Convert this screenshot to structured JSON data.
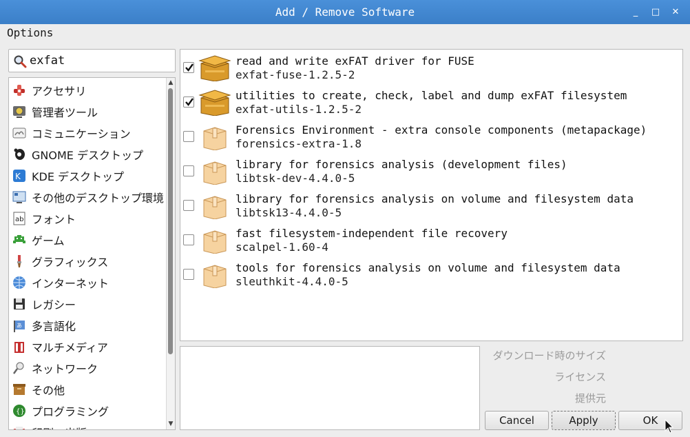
{
  "window": {
    "title": "Add / Remove Software",
    "minimize": "_",
    "maximize": "□",
    "close": "✕"
  },
  "menu": {
    "options": "Options"
  },
  "search": {
    "value": "exfat",
    "icon": "search-icon"
  },
  "categories": [
    {
      "label": "アクセサリ",
      "icon": "accessories-icon"
    },
    {
      "label": "管理者ツール",
      "icon": "admin-tools-icon"
    },
    {
      "label": "コミュニケーション",
      "icon": "communication-icon"
    },
    {
      "label": "GNOME デスクトップ",
      "icon": "gnome-icon"
    },
    {
      "label": "KDE デスクトップ",
      "icon": "kde-icon"
    },
    {
      "label": "その他のデスクトップ環境",
      "icon": "desktop-icon"
    },
    {
      "label": "フォント",
      "icon": "font-icon"
    },
    {
      "label": "ゲーム",
      "icon": "game-icon"
    },
    {
      "label": "グラフィックス",
      "icon": "graphics-icon"
    },
    {
      "label": "インターネット",
      "icon": "globe-icon"
    },
    {
      "label": "レガシー",
      "icon": "floppy-icon"
    },
    {
      "label": "多言語化",
      "icon": "localization-icon"
    },
    {
      "label": "マルチメディア",
      "icon": "multimedia-icon"
    },
    {
      "label": "ネットワーク",
      "icon": "network-icon"
    },
    {
      "label": "その他",
      "icon": "other-icon"
    },
    {
      "label": "プログラミング",
      "icon": "programming-icon"
    },
    {
      "label": "印刷・出版",
      "icon": "publishing-icon"
    }
  ],
  "packages": [
    {
      "summary": "read and write exFAT driver for FUSE",
      "name": "exfat-fuse-1.2.5-2",
      "installed": true
    },
    {
      "summary": "utilities to create, check, label and dump exFAT filesystem",
      "name": "exfat-utils-1.2.5-2",
      "installed": true
    },
    {
      "summary": "Forensics Environment - extra console components (metapackage)",
      "name": "forensics-extra-1.8",
      "installed": false
    },
    {
      "summary": "library for forensics analysis (development files)",
      "name": "libtsk-dev-4.4.0-5",
      "installed": false
    },
    {
      "summary": "library for forensics analysis on volume and filesystem data",
      "name": "libtsk13-4.4.0-5",
      "installed": false
    },
    {
      "summary": "fast filesystem-independent file recovery",
      "name": "scalpel-1.60-4",
      "installed": false
    },
    {
      "summary": "tools for forensics analysis on volume and filesystem data",
      "name": "sleuthkit-4.4.0-5",
      "installed": false
    }
  ],
  "details": {
    "download_size_label": "ダウンロード時のサイズ",
    "license_label": "ライセンス",
    "provider_label": "提供元"
  },
  "buttons": {
    "cancel": "Cancel",
    "apply": "Apply",
    "ok": "OK"
  },
  "colors": {
    "titlebar": "#4a90d9",
    "package_installed": "#c8860d",
    "package_available": "#f3c98b"
  }
}
